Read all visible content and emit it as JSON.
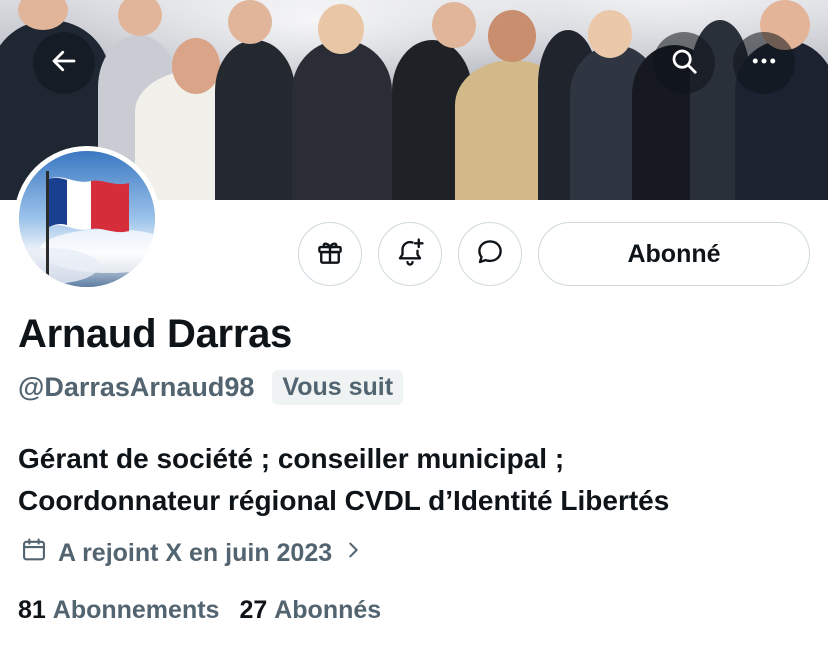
{
  "header": {
    "back_icon": "arrow-left-icon",
    "search_icon": "search-icon",
    "more_icon": "more-horizontal-icon"
  },
  "actions": {
    "gift_icon": "gift-icon",
    "notify_icon": "bell-plus-icon",
    "message_icon": "message-bubble-icon",
    "follow_label": "Abonné"
  },
  "profile": {
    "display_name": "Arnaud Darras",
    "handle": "@DarrasArnaud98",
    "follows_you": "Vous suit",
    "bio_line1": "Gérant de société ; conseiller municipal ;",
    "bio_line2": "Coordonnateur régional CVDL d’Identité Libertés",
    "joined": "A rejoint X en juin 2023"
  },
  "stats": {
    "following_count": "81",
    "following_label": "Abonnements",
    "followers_count": "27",
    "followers_label": "Abonnés"
  },
  "colors": {
    "text_primary": "#0f1419",
    "text_secondary": "#536471",
    "border": "#cfd9de",
    "badge_bg": "#eff3f4"
  }
}
